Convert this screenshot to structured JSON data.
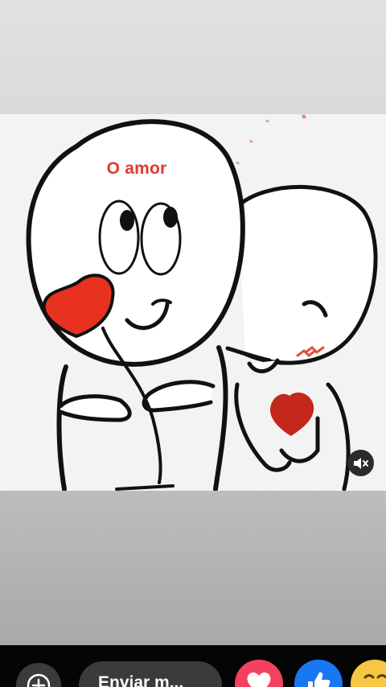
{
  "story": {
    "caption": "O amor",
    "mute_button_icon": "speaker-muted-icon"
  },
  "composer": {
    "add_icon": "add-circle-icon",
    "message_placeholder": "Enviar m..."
  },
  "reactions": [
    {
      "name": "love",
      "icon": "heart-icon",
      "color": "#f3425f"
    },
    {
      "name": "like",
      "icon": "thumbs-up-icon",
      "color": "#1877f2"
    },
    {
      "name": "haha",
      "icon": "laughing-face-icon",
      "color": "#f7c643"
    }
  ],
  "colors": {
    "caption": "#e03a2e",
    "heart": "#e8321f",
    "background_top": "#dedede",
    "background_bottom": "#b3b3b3",
    "bottom_bar": "#050505"
  }
}
